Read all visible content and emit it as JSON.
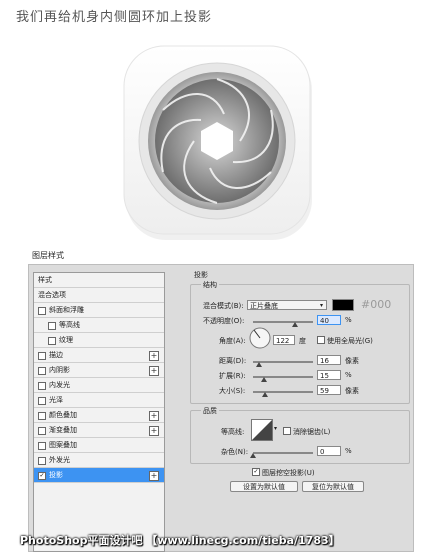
{
  "heading": "我们再给机身内侧圆环加上投影",
  "dialog_title": "图层样式",
  "style_list": [
    {
      "label": "样式",
      "checkbox": false,
      "indent": 0,
      "plus": false,
      "selected": false
    },
    {
      "label": "混合选项",
      "checkbox": false,
      "indent": 0,
      "plus": false,
      "selected": false
    },
    {
      "label": "斜面和浮雕",
      "checkbox": true,
      "checked": false,
      "indent": 0,
      "plus": false,
      "selected": false
    },
    {
      "label": "等高线",
      "checkbox": true,
      "checked": false,
      "indent": 1,
      "plus": false,
      "selected": false
    },
    {
      "label": "纹理",
      "checkbox": true,
      "checked": false,
      "indent": 1,
      "plus": false,
      "selected": false
    },
    {
      "label": "描边",
      "checkbox": true,
      "checked": false,
      "indent": 0,
      "plus": true,
      "selected": false
    },
    {
      "label": "内阴影",
      "checkbox": true,
      "checked": false,
      "indent": 0,
      "plus": true,
      "selected": false
    },
    {
      "label": "内发光",
      "checkbox": true,
      "checked": false,
      "indent": 0,
      "plus": false,
      "selected": false
    },
    {
      "label": "光泽",
      "checkbox": true,
      "checked": false,
      "indent": 0,
      "plus": false,
      "selected": false
    },
    {
      "label": "颜色叠加",
      "checkbox": true,
      "checked": false,
      "indent": 0,
      "plus": true,
      "selected": false
    },
    {
      "label": "渐变叠加",
      "checkbox": true,
      "checked": false,
      "indent": 0,
      "plus": true,
      "selected": false
    },
    {
      "label": "图案叠加",
      "checkbox": true,
      "checked": false,
      "indent": 0,
      "plus": false,
      "selected": false
    },
    {
      "label": "外发光",
      "checkbox": true,
      "checked": false,
      "indent": 0,
      "plus": false,
      "selected": false
    },
    {
      "label": "投影",
      "checkbox": true,
      "checked": true,
      "indent": 0,
      "plus": true,
      "selected": true
    }
  ],
  "panel": {
    "section_title": "投影",
    "structure": {
      "title": "结构",
      "blend_mode_label": "混合模式(B):",
      "blend_mode_value": "正片叠底",
      "color_hex_label": "#000",
      "opacity_label": "不透明度(O):",
      "opacity_value": "40",
      "opacity_unit": "%",
      "opacity_level": 40,
      "angle_label": "角度(A):",
      "angle_value": "122",
      "angle_unit": "度",
      "global_light_label": "使用全局光(G)",
      "distance_label": "距离(D):",
      "distance_value": "16",
      "distance_unit": "像素",
      "spread_label": "扩展(R):",
      "spread_value": "15",
      "spread_unit": "%",
      "size_label": "大小(S):",
      "size_value": "59",
      "size_unit": "像素"
    },
    "quality": {
      "title": "品质",
      "contour_label": "等高线:",
      "antialias_label": "消除锯齿(L)",
      "noise_label": "杂色(N):",
      "noise_value": "0",
      "noise_unit": "%"
    },
    "knockout_label": "图层挖空投影(U)",
    "make_default_label": "设置为默认值",
    "reset_default_label": "复位为默认值"
  },
  "watermark": "PhotoShop平面设计吧 【www.linecg.com/tieba/1783】",
  "colors": {
    "accent": "#3d93f2",
    "shadow_color": "#000000"
  }
}
